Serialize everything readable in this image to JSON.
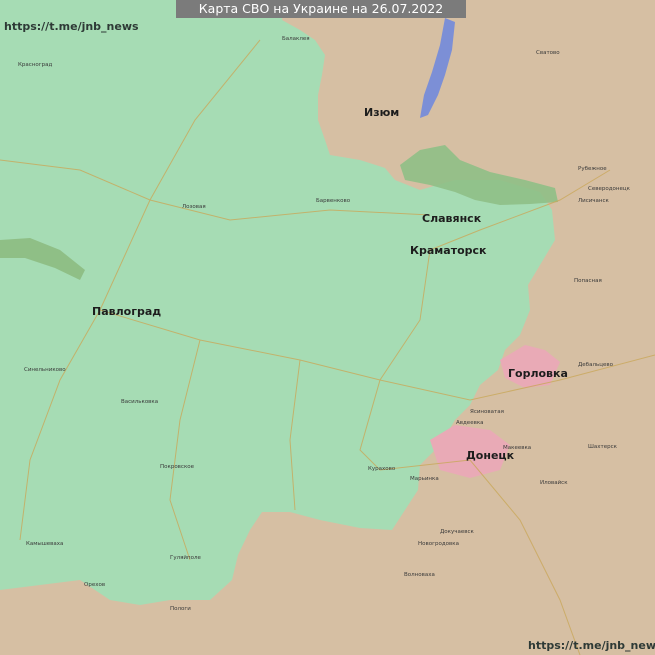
{
  "title": "Карта СВО на Украине на 26.07.2022",
  "watermark_top": "https://t.me/jnb_news",
  "watermark_bottom": "https://t.me/jnb_news",
  "colors": {
    "ukraine_controlled": "#a6dcb4",
    "russia_controlled": "#d6bfa3",
    "contested_forest": "#8fbf86",
    "dpr_city": "#e9aab6",
    "water": "#7c8fd6",
    "roads": "#c9a85a"
  },
  "cities": {
    "izyum": "Изюм",
    "slavyansk": "Славянск",
    "kramatorsk": "Краматорск",
    "pavlograd": "Павлоград",
    "gorlovka": "Горловка",
    "donetsk": "Донецк",
    "avdeevka": "Авдеевка",
    "makeevka": "Макеевка",
    "yasinovataya": "Ясиноватая",
    "kurakhovo": "Курахово",
    "maryinka": "Марьинка",
    "pokrovskoe": "Покровское",
    "vasilkovka": "Васильковка",
    "sinelnikovo": "Синельниково",
    "novogrodovka": "Новогродовка",
    "volnovakha": "Волноваха",
    "dokuchaevsk": "Докучаевск",
    "ilovaysk": "Иловайск",
    "shakhtersk": "Шахтерск",
    "debaltsevo": "Дебальцево",
    "popasnaya": "Попасная",
    "lisichansk": "Лисичанск",
    "severodonetsk": "Северодонецк",
    "rubezhnoe": "Рубежное",
    "svatovo": "Сватово",
    "balakleya": "Балаклея",
    "krasnograd": "Красноград",
    "barvenkovo": "Барвенково",
    "lozovaya": "Лозовая",
    "orekhov": "Орехов",
    "pologi": "Пологи",
    "gulyaypole": "Гуляйполе",
    "kamyshevakha": "Камышеваха"
  }
}
